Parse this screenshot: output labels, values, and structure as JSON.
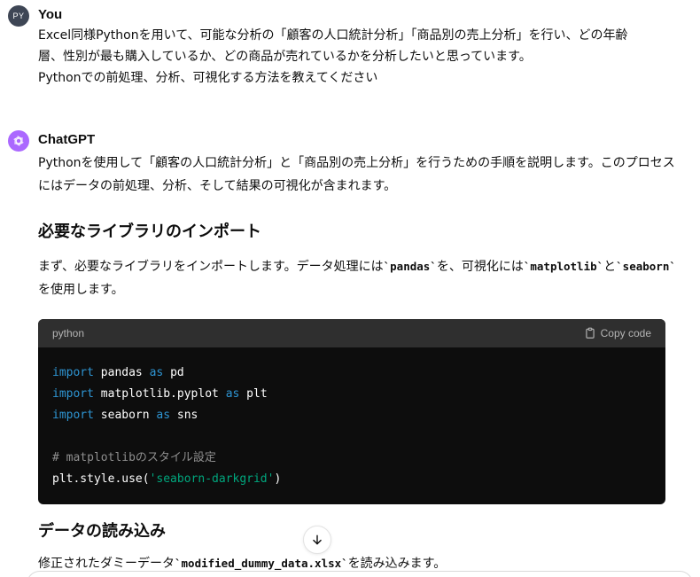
{
  "user": {
    "avatar_initials": "PY",
    "name": "You",
    "lines": [
      "Excel同様Pythonを用いて、可能な分析の「顧客の人口統計分析」「商品別の売上分析」を行い、どの年齢",
      "層、性別が最も購入しているか、どの商品が売れているかを分析したいと思っています。",
      "Pythonでの前処理、分析、可視化する方法を教えてください"
    ]
  },
  "assistant": {
    "name": "ChatGPT",
    "intro_lines": [
      "Pythonを使用して「顧客の人口統計分析」と「商品別の売上分析」を行うための手順を説明します。このプロセス",
      "にはデータの前処理、分析、そして結果の可視化が含まれます。"
    ],
    "section1_title": "必要なライブラリのインポート",
    "section1_text": {
      "part1": "まず、必要なライブラリをインポートします。データ処理には",
      "code1": "`pandas`",
      "part2": "を、可視化には",
      "code2": "`matplotlib`",
      "part3": "と",
      "code3": "`seaborn`",
      "line2": "を使用します。"
    },
    "code_block": {
      "language": "python",
      "copy_label": "Copy code",
      "lines": {
        "l1_kw": "import",
        "l1_rest": " pandas ",
        "l1_kw2": "as",
        "l1_end": " pd",
        "l2_kw": "import",
        "l2_rest": " matplotlib.pyplot ",
        "l2_kw2": "as",
        "l2_end": " plt",
        "l3_kw": "import",
        "l3_rest": " seaborn ",
        "l3_kw2": "as",
        "l3_end": " sns",
        "l5_comment": "# matplotlibのスタイル設定",
        "l6_pre": "plt.style.use(",
        "l6_str": "'seaborn-darkgrid'",
        "l6_post": ")"
      }
    },
    "section2_title": "データの読み込み",
    "section2_text": {
      "part1": "修正されたダミーデータ",
      "code1": "`modified_dummy_data.xlsx`",
      "part2": "を読み込みます。"
    }
  },
  "icons": {
    "assistant_logo": "openai-logo-icon",
    "copy": "clipboard-icon",
    "scroll_down": "arrow-down-icon"
  },
  "colors": {
    "assistant_avatar": "#ab68ff",
    "user_avatar": "#3e4655",
    "code_keyword": "#2e95d3",
    "code_string": "#00a67d",
    "code_comment": "#8e8e8e"
  }
}
